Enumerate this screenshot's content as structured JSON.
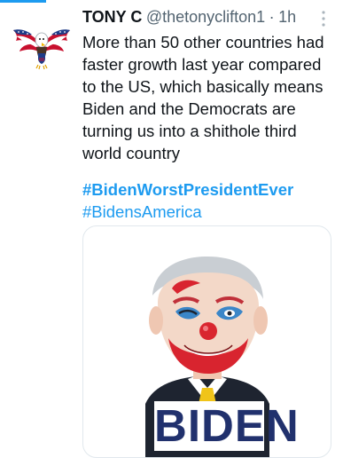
{
  "tweet": {
    "display_name": "TONY C",
    "handle": "@thetonyclifton1",
    "separator": "·",
    "time": "1h",
    "text": "More than 50 other countries had faster growth last year compared to the US, which basically means Biden and the Democrats are turning us into a shithole third world country",
    "hashtags": [
      "#BidenWorstPresidentEver",
      "#BidensAmerica"
    ],
    "avatar_icon": "eagle-flag-icon",
    "more_icon": "more-options-icon"
  },
  "media": {
    "caption": "BIDEN",
    "caption_color": "#21316d"
  },
  "colors": {
    "accent": "#1d9bf0",
    "text": "#0f1419",
    "muted": "#536471"
  }
}
